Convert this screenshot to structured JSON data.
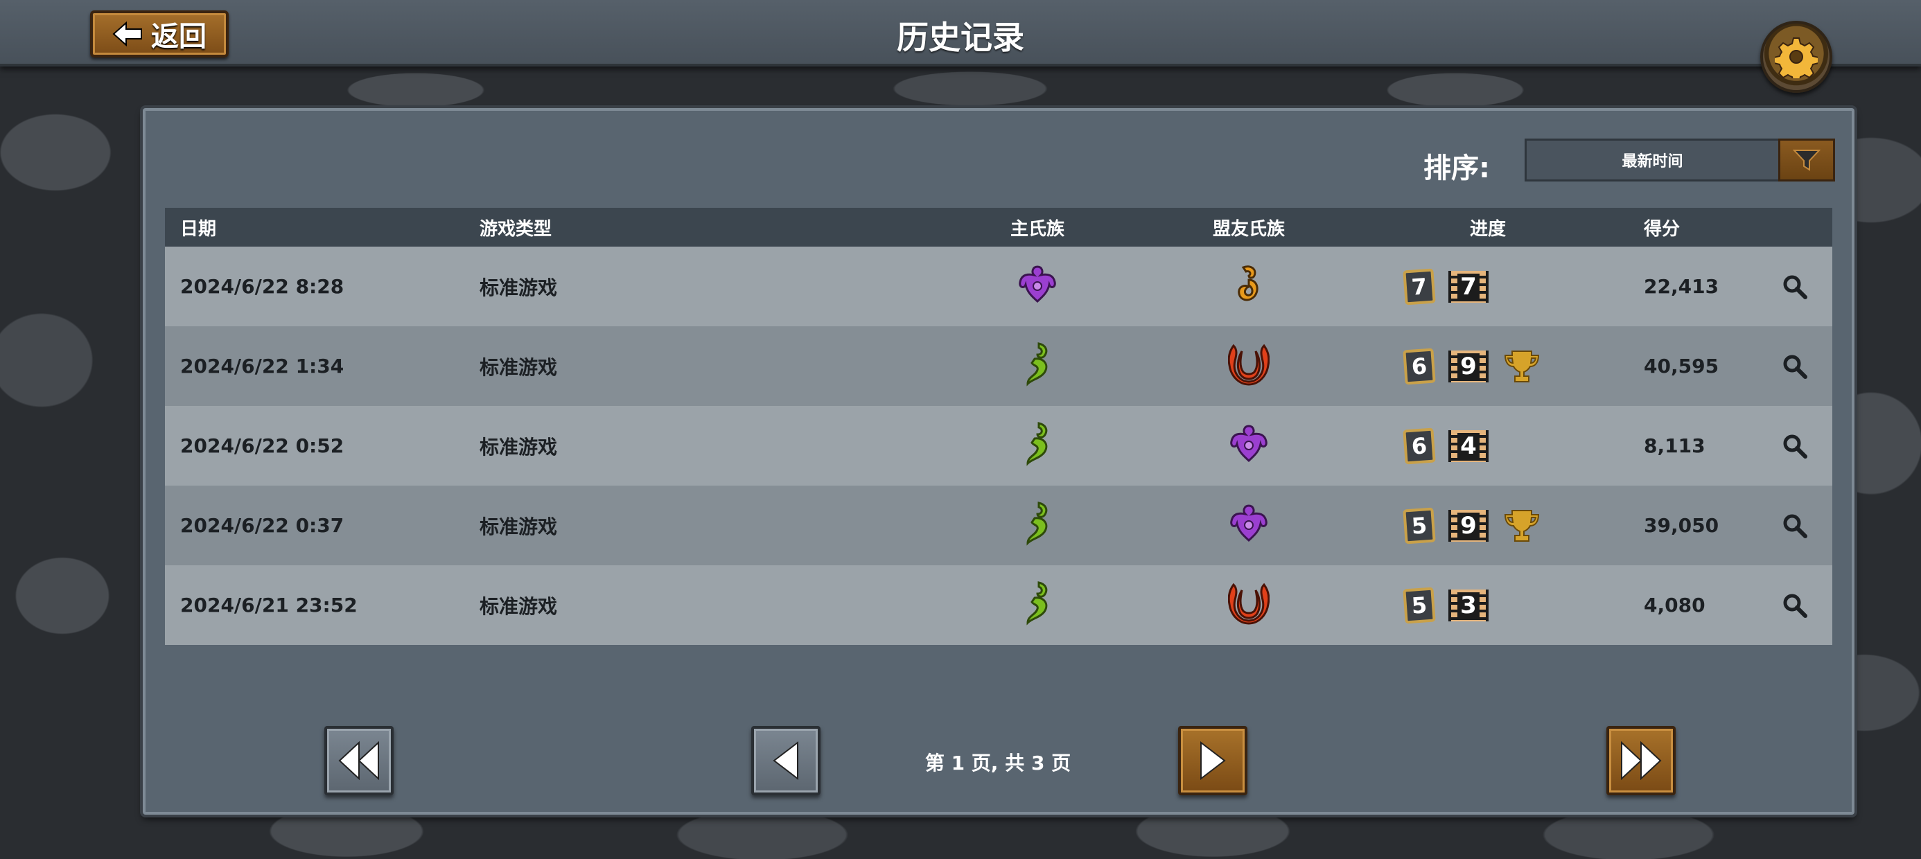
{
  "header": {
    "title": "历史记录",
    "back_label": "返回"
  },
  "sort": {
    "label": "排序:",
    "value": "最新时间"
  },
  "table": {
    "columns": [
      "日期",
      "游戏类型",
      "主氏族",
      "盟友氏族",
      "进度",
      "得分"
    ],
    "rows": [
      {
        "date": "2024/6/22 8:28",
        "type": "标准游戏",
        "main_clan": "purple-clan-icon",
        "ally_clan": "orange-clan-icon",
        "stat_a": "7",
        "stat_b": "7",
        "trophy": false,
        "score": "22,413"
      },
      {
        "date": "2024/6/22 1:34",
        "type": "标准游戏",
        "main_clan": "green-clan-icon",
        "ally_clan": "red-clan-icon",
        "stat_a": "6",
        "stat_b": "9",
        "trophy": true,
        "score": "40,595"
      },
      {
        "date": "2024/6/22 0:52",
        "type": "标准游戏",
        "main_clan": "green-clan-icon",
        "ally_clan": "purple-clan-icon",
        "stat_a": "6",
        "stat_b": "4",
        "trophy": false,
        "score": "8,113"
      },
      {
        "date": "2024/6/22 0:37",
        "type": "标准游戏",
        "main_clan": "green-clan-icon",
        "ally_clan": "purple-clan-icon",
        "stat_a": "5",
        "stat_b": "9",
        "trophy": true,
        "score": "39,050"
      },
      {
        "date": "2024/6/21 23:52",
        "type": "标准游戏",
        "main_clan": "green-clan-icon",
        "ally_clan": "red-clan-icon",
        "stat_a": "5",
        "stat_b": "3",
        "trophy": false,
        "score": "4,080"
      }
    ]
  },
  "pagination": {
    "text": "第 1 页, 共 3 页",
    "current": 1,
    "total": 3
  },
  "colors": {
    "purple": "#9b3fd0",
    "green": "#7bbf1e",
    "orange": "#e89a1c",
    "red": "#e0401a",
    "gold": "#d6a32a"
  }
}
